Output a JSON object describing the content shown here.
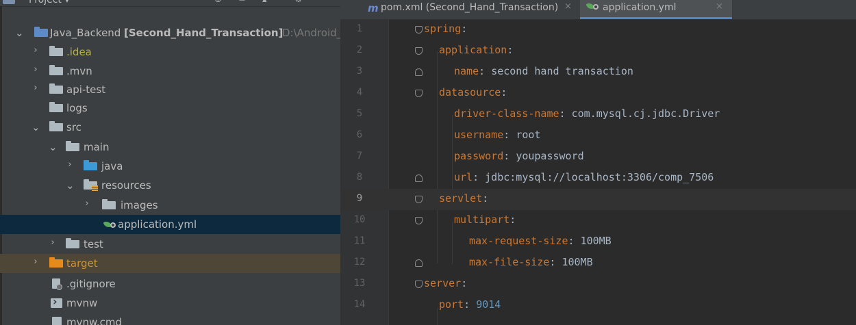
{
  "project_panel": {
    "title": "Project",
    "title_arrow": "▾",
    "toolbar": {
      "locate": "⊕",
      "collapse": "≚",
      "options": "⚙",
      "hide": "—"
    },
    "root": {
      "name": "Java_Backend",
      "module": "[Second_Hand_Transaction]",
      "path": "D:\\Android_Pro"
    },
    "items": [
      {
        "label": ".idea"
      },
      {
        "label": ".mvn"
      },
      {
        "label": "api-test"
      },
      {
        "label": "logs"
      },
      {
        "label": "src"
      },
      {
        "label": "main"
      },
      {
        "label": "java"
      },
      {
        "label": "resources"
      },
      {
        "label": "images"
      },
      {
        "label": "application.yml"
      },
      {
        "label": "test"
      },
      {
        "label": "target"
      },
      {
        "label": ".gitignore"
      },
      {
        "label": "mvnw"
      },
      {
        "label": "mvnw.cmd"
      }
    ]
  },
  "editor": {
    "tabs": [
      {
        "label": "pom.xml (Second_Hand_Transaction)",
        "icon": "maven-icon",
        "close": "×"
      },
      {
        "label": "application.yml",
        "icon": "spring-config-icon",
        "close": "×"
      }
    ],
    "current_line": 9,
    "lines": [
      {
        "num": "1",
        "key": "spring",
        "sep": ":",
        "value": ""
      },
      {
        "num": "2",
        "key": "application",
        "sep": ":",
        "value": ""
      },
      {
        "num": "3",
        "key": "name",
        "sep": ": ",
        "value": "second hand transaction"
      },
      {
        "num": "4",
        "key": "datasource",
        "sep": ":",
        "value": ""
      },
      {
        "num": "5",
        "key": "driver-class-name",
        "sep": ": ",
        "value": "com.mysql.cj.jdbc.Driver"
      },
      {
        "num": "6",
        "key": "username",
        "sep": ": ",
        "value": "root"
      },
      {
        "num": "7",
        "key": "password",
        "sep": ": ",
        "value": "youpassword"
      },
      {
        "num": "8",
        "key": "url",
        "sep": ": ",
        "value": "jdbc:mysql://localhost:3306/comp_7506"
      },
      {
        "num": "9",
        "key": "servlet",
        "sep": ":",
        "value": ""
      },
      {
        "num": "10",
        "key": "multipart",
        "sep": ":",
        "value": ""
      },
      {
        "num": "11",
        "key": "max-request-size",
        "sep": ": ",
        "value": "100MB"
      },
      {
        "num": "12",
        "key": "max-file-size",
        "sep": ": ",
        "value": "100MB"
      },
      {
        "num": "13",
        "key": "server",
        "sep": ":",
        "value": ""
      },
      {
        "num": "14",
        "key": "port",
        "sep": ": ",
        "value": "9014"
      }
    ]
  }
}
